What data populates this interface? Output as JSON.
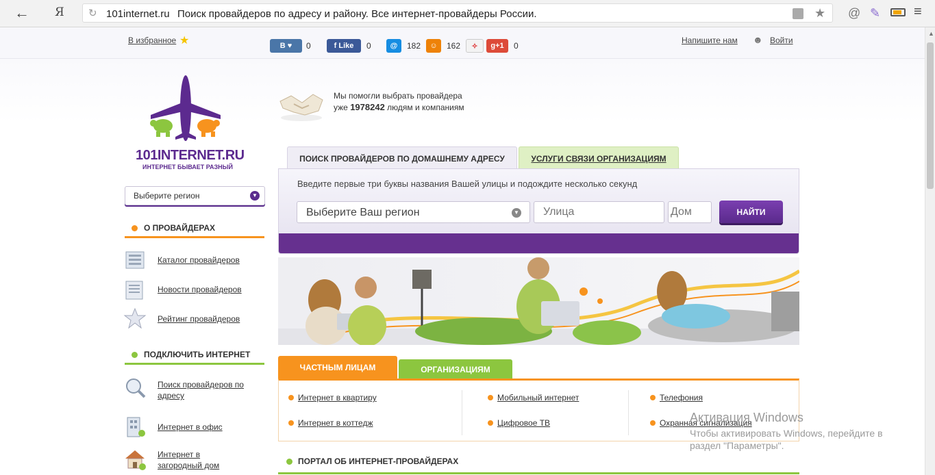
{
  "browser": {
    "back_icon": "back-arrow-icon",
    "yandex_glyph": "Я",
    "domain": "101internet.ru",
    "title": "Поиск провайдеров по адресу и району. Все интернет-провайдеры России."
  },
  "topbar": {
    "favorites": "В избранное",
    "social": [
      {
        "label": "В",
        "count": "0",
        "color": "#4a76a8"
      },
      {
        "label": "Like",
        "count": "0",
        "color": "#3b5998"
      },
      {
        "label": "@",
        "count": "182",
        "color": "#168de2"
      },
      {
        "label": "ok",
        "count": "162",
        "color": "#ee8208"
      },
      {
        "label": "+1",
        "count": "0",
        "color": "#dd4b39"
      }
    ],
    "write_us": "Напишите нам",
    "login": "Войти"
  },
  "logo": {
    "text": "101INTERNET.RU",
    "slogan": "ИНТЕРНЕТ БЫВАЕТ РАЗНЫЙ"
  },
  "sidebar": {
    "region_select": "Выберите регион",
    "sections": [
      {
        "title": "О ПРОВАЙДЕРАХ",
        "color": "#f7931e",
        "items": [
          "Каталог провайдеров",
          "Новости провайдеров",
          "Рейтинг провайдеров"
        ]
      },
      {
        "title": "ПОДКЛЮЧИТЬ ИНТЕРНЕТ",
        "color": "#8cc63f",
        "items": [
          "Поиск провайдеров по адресу",
          "Интернет в офис",
          "Интернет в загородный дом"
        ]
      }
    ]
  },
  "helped": {
    "line1": "Мы помогли выбрать провайдера",
    "prefix": "уже",
    "count": "1978242",
    "suffix": "людям и компаниям"
  },
  "search": {
    "tabs": [
      "ПОИСК ПРОВАЙДЕРОВ ПО ДОМАШНЕМУ АДРЕСУ",
      "УСЛУГИ СВЯЗИ ОРГАНИЗАЦИЯМ"
    ],
    "hint": "Введите первые три буквы названия Вашей улицы и подождите несколько секунд",
    "region_placeholder": "Выберите Ваш регион",
    "street_placeholder": "Улица",
    "house_placeholder": "Дом",
    "button": "НАЙТИ"
  },
  "services": {
    "tabs": [
      "ЧАСТНЫМ ЛИЦАМ",
      "ОРГАНИЗАЦИЯМ"
    ],
    "items": [
      "Интернет в квартиру",
      "Интернет в коттедж",
      "Мобильный интернет",
      "Цифровое ТВ",
      "Телефония",
      "Охранная сигнализация"
    ]
  },
  "portal_title": "ПОРТАЛ ОБ ИНТЕРНЕТ-ПРОВАЙДЕРАХ",
  "watermark": {
    "line1": "Активация Windows",
    "line2": "Чтобы активировать Windows, перейдите в",
    "line3": "раздел \"Параметры\"."
  }
}
